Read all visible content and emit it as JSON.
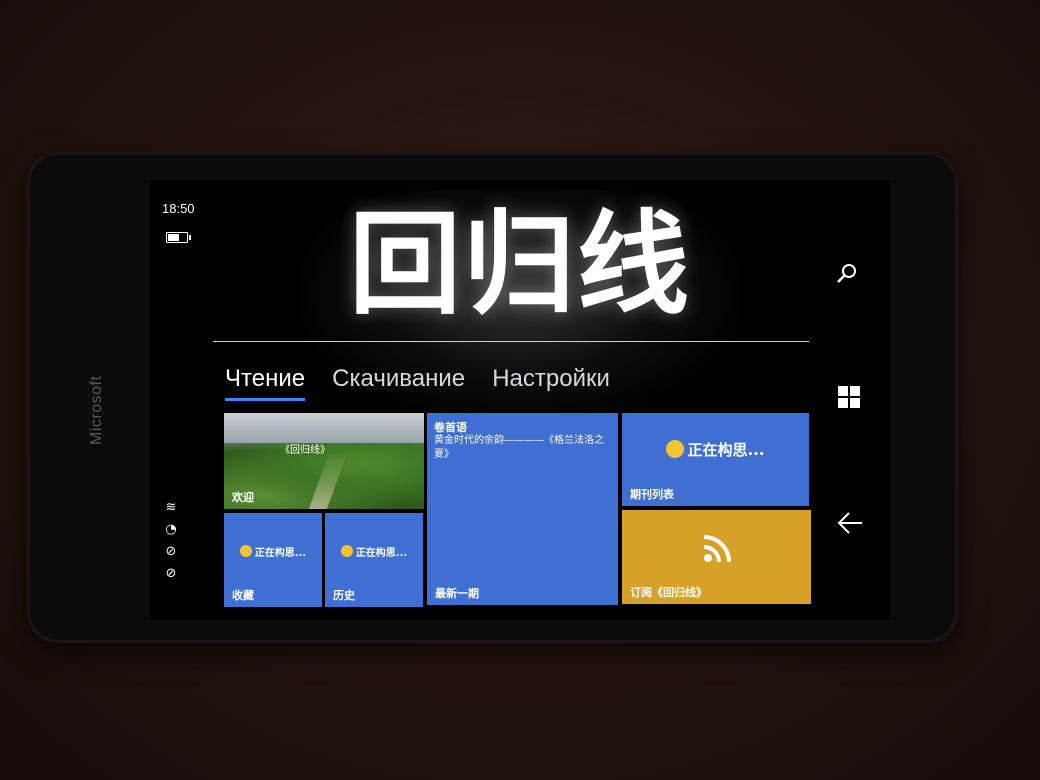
{
  "device": {
    "brand": "Microsoft"
  },
  "status": {
    "time": "18:50"
  },
  "app": {
    "logo": "回归线"
  },
  "tabs": [
    {
      "label": "Чтение",
      "active": true
    },
    {
      "label": "Скачивание",
      "active": false
    },
    {
      "label": "Настройки",
      "active": false
    }
  ],
  "tiles": {
    "welcome": {
      "label": "欢迎",
      "overlay": "《回归线》"
    },
    "preface": {
      "title": "卷首语",
      "text": "黄金时代的余韵————《格兰法洛之夏》",
      "label": "最新一期"
    },
    "periodicals": {
      "status": "正在构思...",
      "label": "期刊列表"
    },
    "favorites": {
      "status": "正在构思...",
      "label": "收藏"
    },
    "history": {
      "status": "正在构思...",
      "label": "历史"
    },
    "subscribe": {
      "icon": "rss-icon",
      "label": "订阅《回归线》"
    }
  },
  "nav": {
    "search": "search-icon",
    "start": "windows-icon",
    "back": "back-arrow-icon"
  },
  "colors": {
    "tile_blue": "#3f6fd2",
    "tile_gold": "#d6a126",
    "accent": "#3d82ff"
  }
}
